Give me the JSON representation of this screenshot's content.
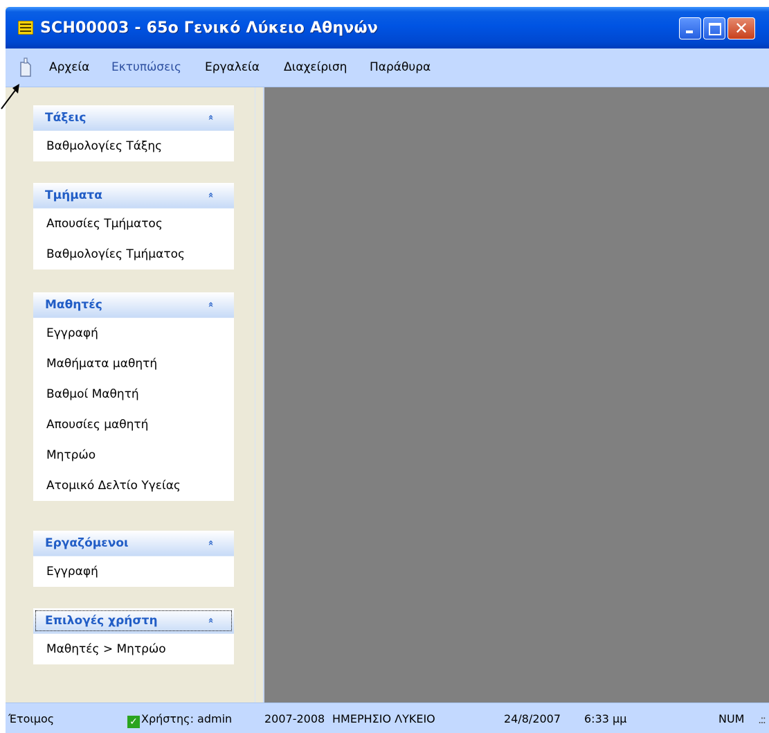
{
  "window": {
    "title": "SCH00003 - 65ο Γενικό Λύκειο Αθηνών",
    "close_glyph": "✕"
  },
  "menu": {
    "items": [
      "Αρχεία",
      "Εκτυπώσεις",
      "Εργαλεία",
      "Διαχείριση",
      "Παράθυρα"
    ]
  },
  "sidebar": {
    "groups": [
      {
        "title": "Τάξεις",
        "chevron": "»",
        "links": [
          "Βαθμολογίες Τάξης"
        ]
      },
      {
        "title": "Τμήματα",
        "chevron": "»",
        "links": [
          "Απουσίες Τμήματος",
          "Βαθμολογίες Τμήματος"
        ]
      },
      {
        "title": "Μαθητές",
        "chevron": "»",
        "links": [
          "Εγγραφή",
          "Μαθήματα μαθητή",
          "Βαθμοί Μαθητή",
          "Απουσίες μαθητή",
          "Μητρώο",
          "Ατομικό Δελτίο Υγείας"
        ]
      },
      {
        "title": "Εργαζόμενοι",
        "chevron": "»",
        "links": [
          "Εγγραφή"
        ]
      },
      {
        "title": "Επιλογές χρήστη",
        "chevron": "»",
        "links": [
          "Μαθητές > Μητρώο"
        ]
      }
    ]
  },
  "status": {
    "ready": "Έτοιμος",
    "check_glyph": "✓",
    "user": "Χρήστης: admin",
    "school_year": "2007-2008",
    "school_type": "ΗΜΕΡΗΣΙΟ ΛΥΚΕΙΟ",
    "date": "24/8/2007",
    "time": "6:33 μμ",
    "num": "NUM",
    "grip": ".::"
  },
  "colors": {
    "titlebar": "#0054e3",
    "menubar": "#c3d9ff",
    "workspace": "#808080",
    "group_title": "#215dc6",
    "panel": "#ece9d8"
  }
}
